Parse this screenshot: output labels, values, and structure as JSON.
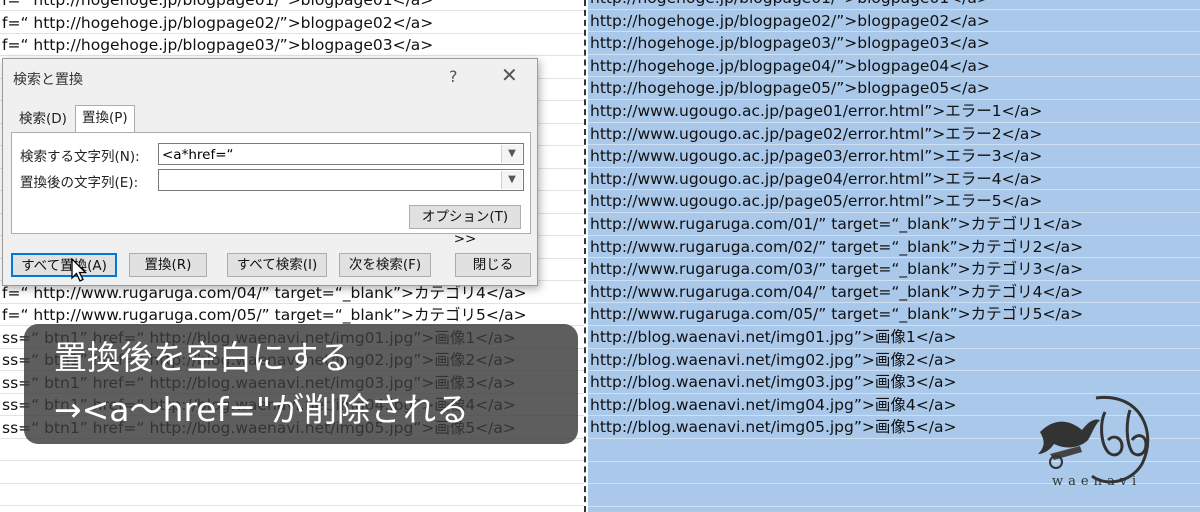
{
  "left_rows": [
    "f=“ http://hogehoge.jp/blogpage01/”>blogpage01</a>",
    "f=“ http://hogehoge.jp/blogpage02/”>blogpage02</a>",
    "f=“ http://hogehoge.jp/blogpage03/”>blogpage03</a>",
    "",
    "",
    "",
    "",
    "",
    "",
    "",
    "",
    "",
    "",
    "f=“ http://www.rugaruga.com/04/”  target=“_blank”>カテゴリ4</a>",
    "f=“ http://www.rugaruga.com/05/”  target=“_blank”>カテゴリ5</a>",
    "ss=“ btn1”  href=“ http://blog.waenavi.net/img01.jpg”>画像1</a>",
    "ss=“ btn1”  href=“ http://blog.waenavi.net/img02.jpg”>画像2</a>",
    "ss=“ btn1”  href=“ http://blog.waenavi.net/img03.jpg”>画像3</a>",
    "ss=“ btn1”  href=“ http://blog.waenavi.net/img04.jpg”>画像4</a>",
    "ss=“ btn1”  href=“ http://blog.waenavi.net/img05.jpg”>画像5</a>",
    "",
    "",
    ""
  ],
  "right_rows": [
    "http://hogehoge.jp/blogpage01/”>blogpage01</a>",
    "http://hogehoge.jp/blogpage02/”>blogpage02</a>",
    "http://hogehoge.jp/blogpage03/”>blogpage03</a>",
    "http://hogehoge.jp/blogpage04/”>blogpage04</a>",
    "http://hogehoge.jp/blogpage05/”>blogpage05</a>",
    "http://www.ugougo.ac.jp/page01/error.html”>エラー1</a>",
    "http://www.ugougo.ac.jp/page02/error.html”>エラー2</a>",
    "http://www.ugougo.ac.jp/page03/error.html”>エラー3</a>",
    "http://www.ugougo.ac.jp/page04/error.html”>エラー4</a>",
    "http://www.ugougo.ac.jp/page05/error.html”>エラー5</a>",
    "http://www.rugaruga.com/01/”  target=“_blank”>カテゴリ1</a>",
    "http://www.rugaruga.com/02/”  target=“_blank”>カテゴリ2</a>",
    "http://www.rugaruga.com/03/”  target=“_blank”>カテゴリ3</a>",
    "http://www.rugaruga.com/04/”  target=“_blank”>カテゴリ4</a>",
    "http://www.rugaruga.com/05/”  target=“_blank”>カテゴリ5</a>",
    "http://blog.waenavi.net/img01.jpg”>画像1</a>",
    "http://blog.waenavi.net/img02.jpg”>画像2</a>",
    "http://blog.waenavi.net/img03.jpg”>画像3</a>",
    "http://blog.waenavi.net/img04.jpg”>画像4</a>",
    "http://blog.waenavi.net/img05.jpg”>画像5</a>",
    "",
    "",
    ""
  ],
  "dialog": {
    "title": "検索と置換",
    "help": "?",
    "close": "✕",
    "tabs": {
      "search": "検索(D)",
      "replace": "置換(P)"
    },
    "find_label": "検索する文字列(N):",
    "find_value": "<a*href=“",
    "replace_label": "置換後の文字列(E):",
    "replace_value": "",
    "options_label": "オプション(T) >>",
    "buttons": {
      "replace_all": "すべて置換(A)",
      "replace": "置換(R)",
      "find_all": "すべて検索(I)",
      "find_next": "次を検索(F)",
      "close": "閉じる"
    }
  },
  "caption": {
    "line1": "置換後を空白にする",
    "line2": "→<a～href=\"が削除される"
  },
  "logo": {
    "text": "waenavi"
  },
  "colors": {
    "selection_blue": "#a9c8ea",
    "dialog_bg": "#f0f0f0",
    "caption_bg": "#3a3a3a"
  }
}
